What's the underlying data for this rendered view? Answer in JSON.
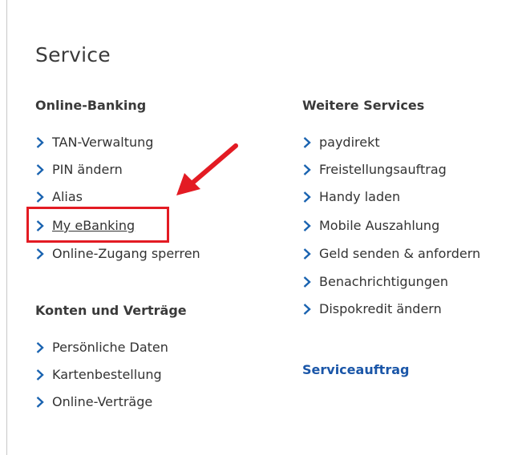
{
  "page": {
    "title": "Service"
  },
  "colors": {
    "chevron": "#1a63b0",
    "highlight": "#e31b23",
    "link": "#1a56a8"
  },
  "online_banking": {
    "heading": "Online-Banking",
    "items": [
      {
        "label": "TAN-Verwaltung"
      },
      {
        "label": "PIN ändern"
      },
      {
        "label": "Alias"
      },
      {
        "label": "My eBanking"
      },
      {
        "label": "Online-Zugang sperren"
      }
    ]
  },
  "konten": {
    "heading": "Konten und Verträge",
    "items": [
      {
        "label": "Persönliche Daten"
      },
      {
        "label": "Kartenbestellung"
      },
      {
        "label": "Online-Verträge"
      }
    ]
  },
  "weitere": {
    "heading": "Weitere Services",
    "items": [
      {
        "label": "paydirekt"
      },
      {
        "label": "Freistellungsauftrag"
      },
      {
        "label": "Handy laden"
      },
      {
        "label": "Mobile Auszahlung"
      },
      {
        "label": "Geld senden & anfordern"
      },
      {
        "label": "Benachrichtigungen"
      },
      {
        "label": "Dispokredit ändern"
      }
    ]
  },
  "serviceauftrag": {
    "label": "Serviceauftrag"
  },
  "annotation": {
    "icon": "red-arrow-icon"
  }
}
